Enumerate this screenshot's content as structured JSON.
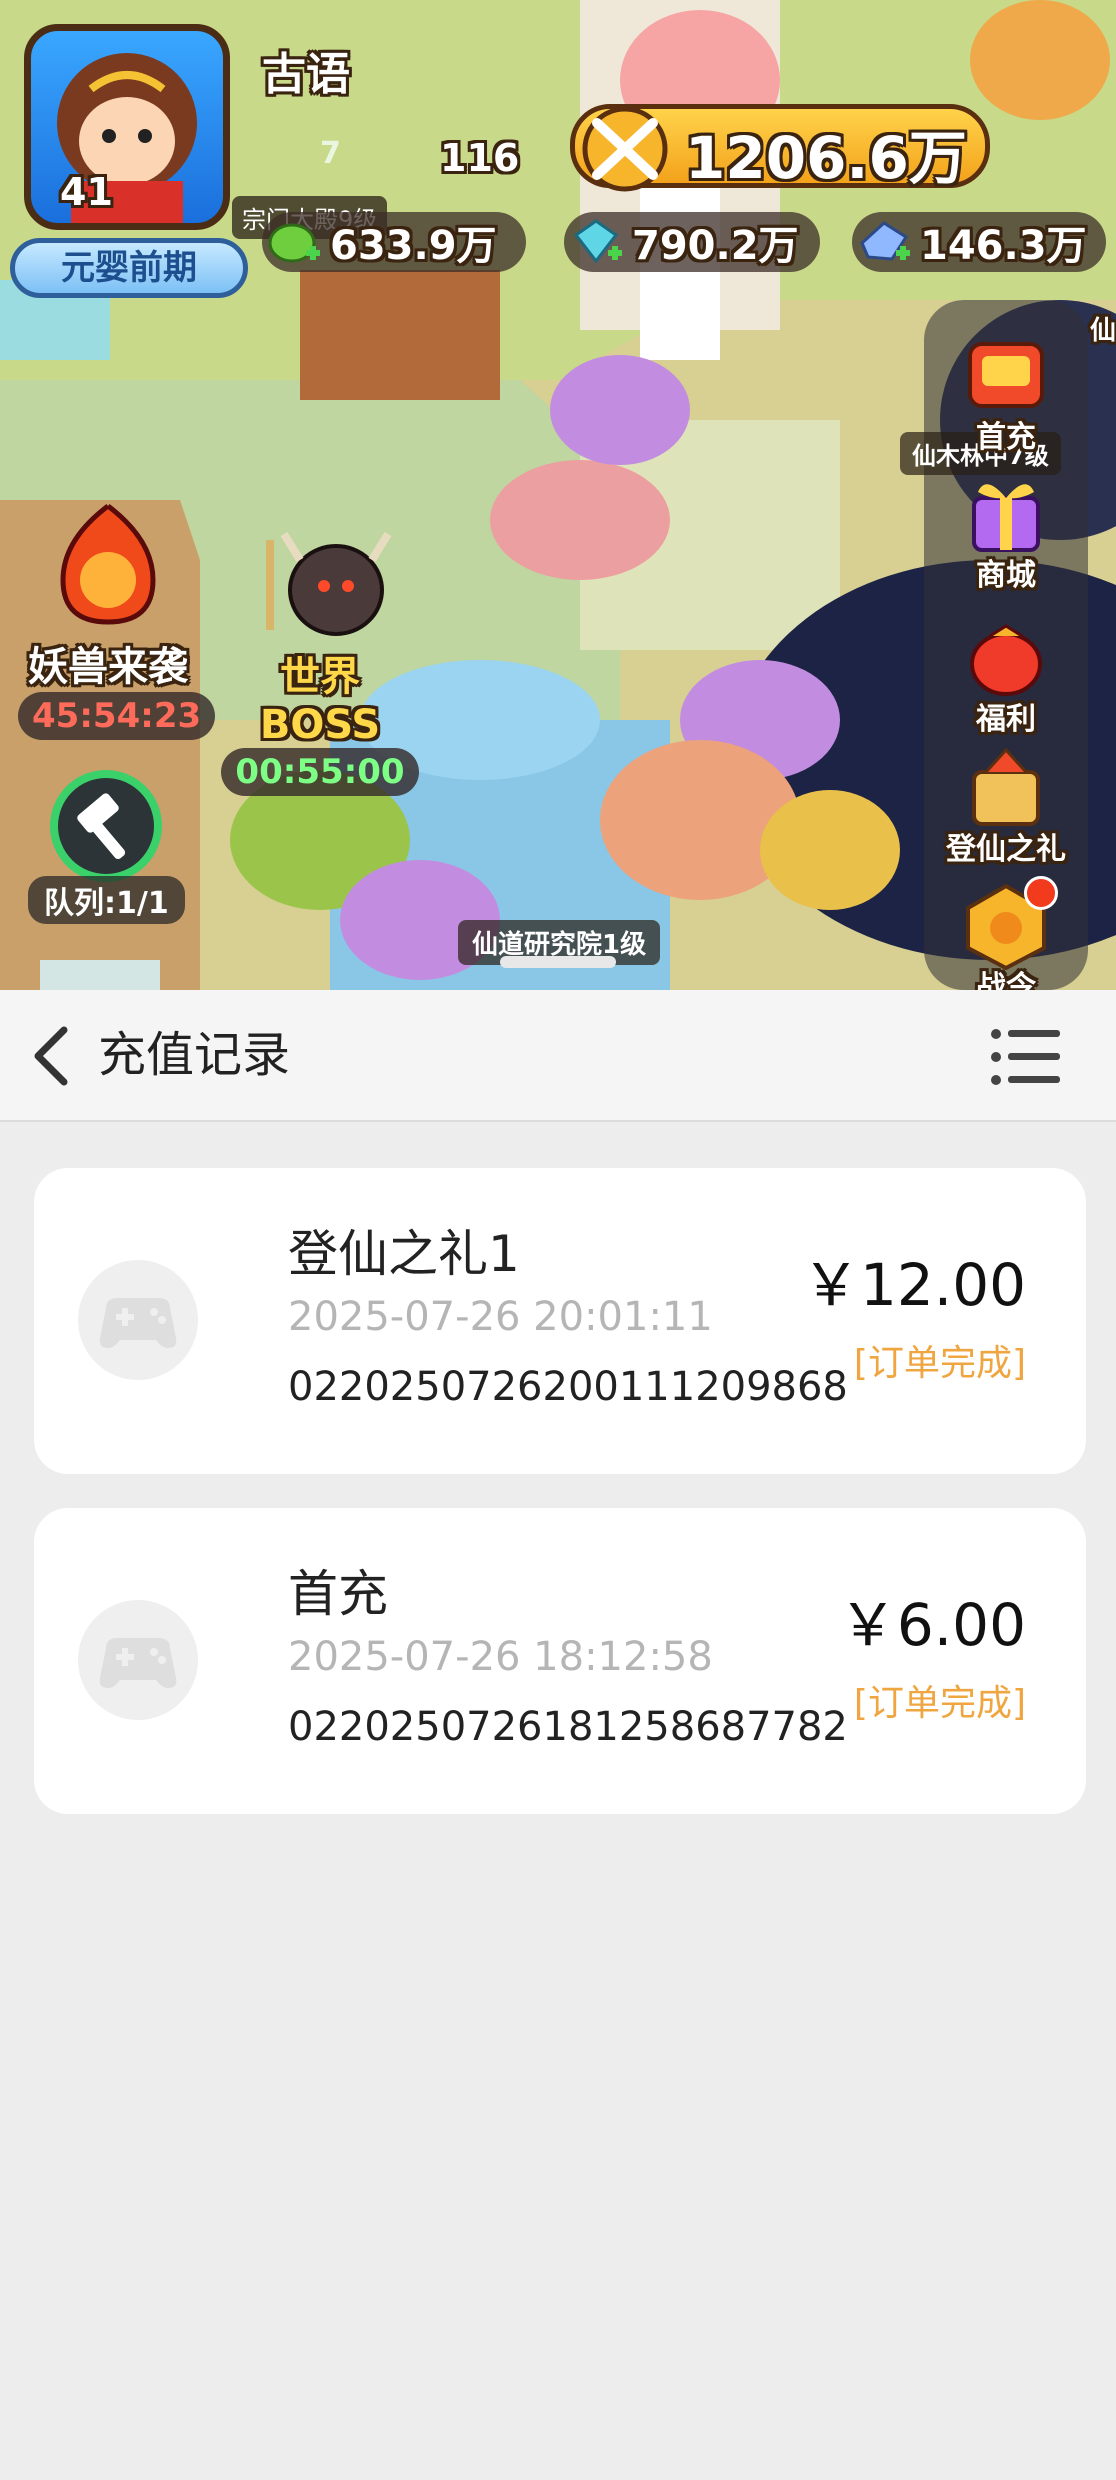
{
  "game": {
    "player_name": "古语",
    "level": "41",
    "realm": "元婴前期",
    "gem_count": "7",
    "small_stat": "116",
    "hall_label": "宗门大殿9级",
    "combat_power": "1206.6万",
    "resources": [
      {
        "icon": "green-jade-icon",
        "value": "633.9万"
      },
      {
        "icon": "blue-crystal-icon",
        "value": "790.2万"
      },
      {
        "icon": "spirit-stone-icon",
        "value": "146.3万"
      }
    ],
    "edge_label": "仙",
    "menu": [
      {
        "icon": "first-charge-icon",
        "label": "首充"
      },
      {
        "icon": "shop-gift-icon",
        "label": "商城"
      },
      {
        "icon": "welfare-bag-icon",
        "label": "福利"
      },
      {
        "icon": "ascension-gift-icon",
        "label": "登仙之礼"
      },
      {
        "icon": "battle-pass-icon",
        "label": "战令"
      }
    ],
    "tree_label": "仙木林中7级",
    "events": [
      {
        "icon": "demon-beast-icon",
        "label": "妖兽来袭",
        "timer": "45:54:23",
        "timer_color": "#ff6b5a"
      },
      {
        "icon": "world-boss-icon",
        "label": "世界BOSS",
        "timer": "00:55:00",
        "timer_color": "#7dff86"
      }
    ],
    "queue_label": "队列:1/1",
    "lab_label": "仙道研究院1级"
  },
  "header": {
    "title": "充值记录"
  },
  "records": [
    {
      "name": "登仙之礼1",
      "time": "2025-07-26 20:01:11",
      "order_no": "022025072620011120986​8",
      "amount": "￥12.00",
      "status": "[订单完成]"
    },
    {
      "name": "首充",
      "time": "2025-07-26 18:12:58",
      "order_no": "022025072618125868778​2",
      "amount": "￥6.00",
      "status": "[订单完成]"
    }
  ],
  "colors": {
    "status": "#f0a640",
    "time": "#b5b5b5",
    "page_bg": "#ededed"
  }
}
